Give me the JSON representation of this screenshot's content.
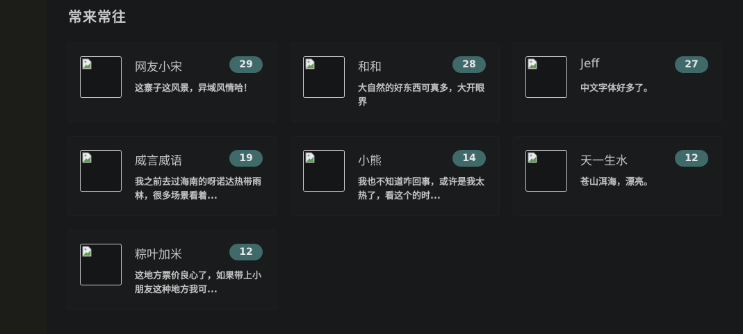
{
  "section": {
    "title": "常来常往"
  },
  "cards": [
    {
      "name": "网友小宋",
      "count": "29",
      "desc": "这寨子这风景，异域风情哈！"
    },
    {
      "name": "和和",
      "count": "28",
      "desc": "大自然的好东西可真多，大开眼界"
    },
    {
      "name": "Jeff",
      "count": "27",
      "desc": "中文字体好多了。"
    },
    {
      "name": "威言威语",
      "count": "19",
      "desc": "我之前去过海南的呀诺达热带雨林，很多场景看着..."
    },
    {
      "name": "小熊",
      "count": "14",
      "desc": "我也不知道咋回事，或许是我太热了，看这个的时..."
    },
    {
      "name": "天一生水",
      "count": "12",
      "desc": "苍山洱海，漂亮。"
    },
    {
      "name": "粽叶加米",
      "count": "12",
      "desc": "这地方票价良心了，如果带上小朋友这种地方我可..."
    }
  ],
  "colors": {
    "badge": "#3f6a69",
    "background": "#18191a",
    "text": "#c4c4c4"
  }
}
